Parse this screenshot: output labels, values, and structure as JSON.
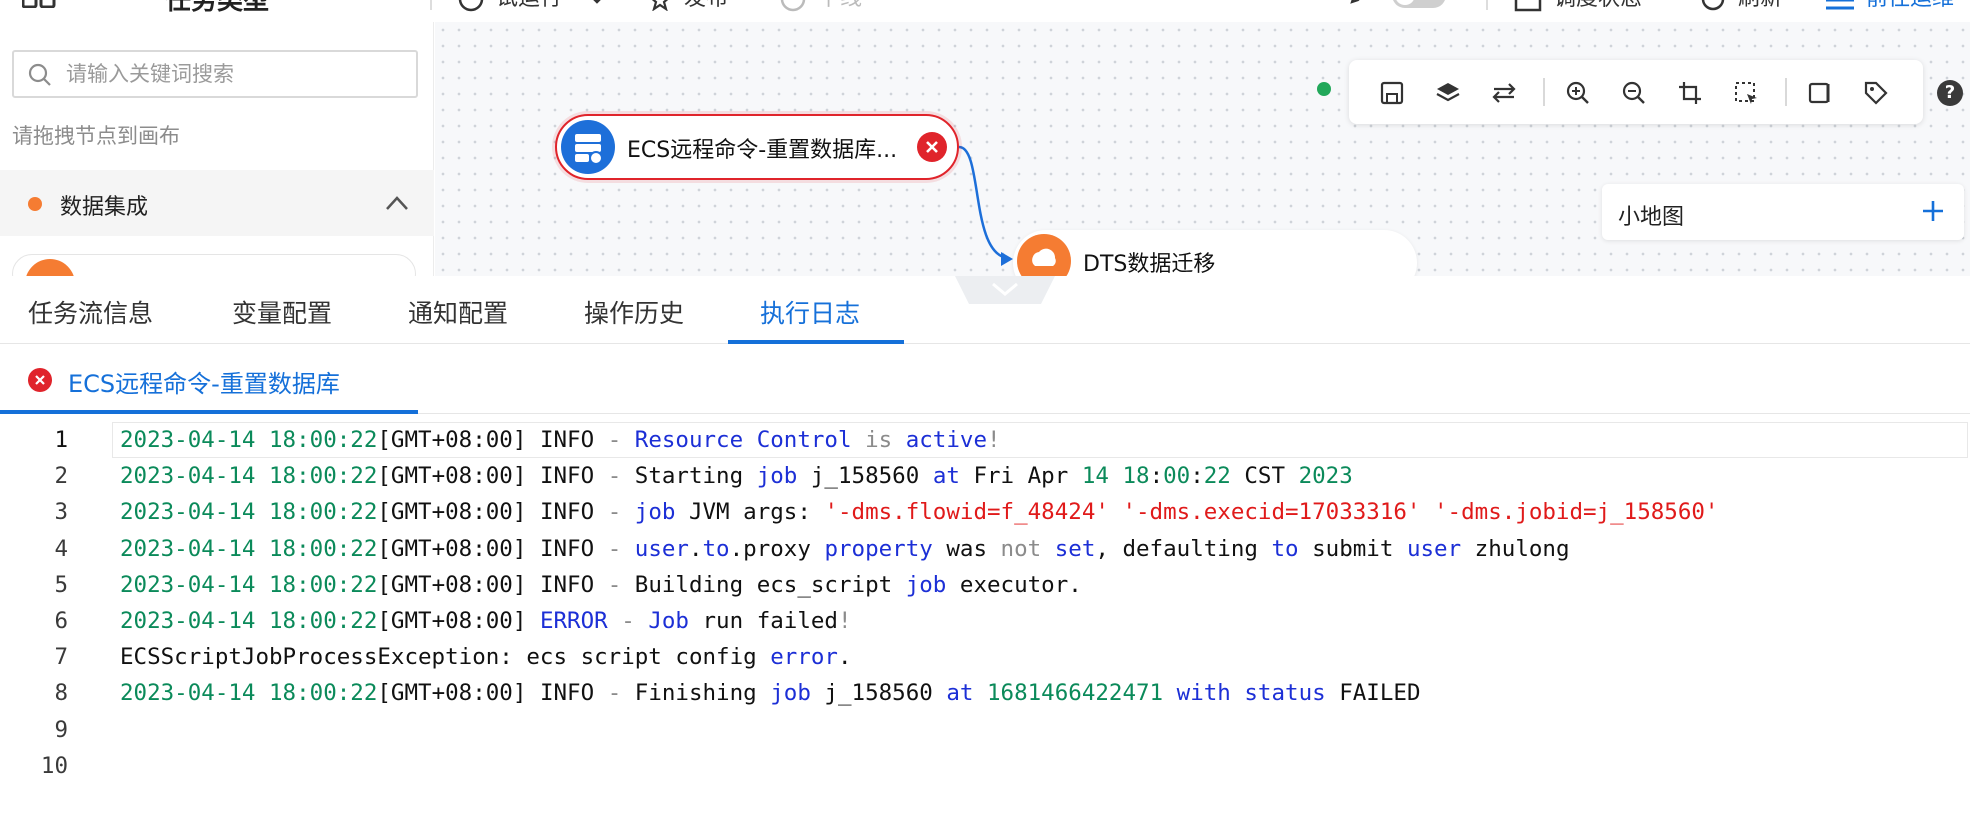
{
  "topbar": {
    "title": "任务类型",
    "run_label": "试运行",
    "publish_label": "发布",
    "offline_label": "下线",
    "schedule_status_label": "调度状态",
    "refresh_label": "刷新",
    "goto_label": "前往运维"
  },
  "left_panel": {
    "search_placeholder": "请输入关键词搜索",
    "drag_hint": "请拖拽节点到画布",
    "category": {
      "label": "数据集成",
      "dot_color": "#f57c32"
    }
  },
  "canvas": {
    "status_color": "#22a85a",
    "tools": [
      "save-icon",
      "layers-icon",
      "swap-icon",
      "zoom-in-icon",
      "zoom-out-icon",
      "crop-icon",
      "select-icon",
      "book-icon",
      "tag-icon"
    ],
    "help_label": "?",
    "minimap_label": "小地图",
    "nodes": [
      {
        "label": "ECS远程命令-重置数据库...",
        "status": "error",
        "icon_color": "#1d6fd9"
      },
      {
        "label": "DTS数据迁移",
        "status": "normal",
        "icon_color": "#f57c32"
      }
    ]
  },
  "bottom_panel": {
    "tabs": [
      {
        "label": "任务流信息",
        "active": false
      },
      {
        "label": "变量配置",
        "active": false
      },
      {
        "label": "通知配置",
        "active": false
      },
      {
        "label": "操作历史",
        "active": false
      },
      {
        "label": "执行日志",
        "active": true
      }
    ],
    "subtab_label": "ECS远程命令-重置数据库",
    "accent_color": "#1570d9",
    "error_color": "#e0242b",
    "log_lines": [
      {
        "num": "1",
        "tokens": [
          {
            "t": "2023-04-14 18:00:22",
            "c": "date"
          },
          {
            "t": "[GMT+08:00] INFO ",
            "c": "plain"
          },
          {
            "t": "- ",
            "c": "op"
          },
          {
            "t": "Resource Control",
            "c": "kw"
          },
          {
            "t": " ",
            "c": "plain"
          },
          {
            "t": "is",
            "c": "op"
          },
          {
            "t": " ",
            "c": "plain"
          },
          {
            "t": "active",
            "c": "kw"
          },
          {
            "t": "!",
            "c": "op"
          }
        ]
      },
      {
        "num": "2",
        "tokens": [
          {
            "t": "2023-04-14 18:00:22",
            "c": "date"
          },
          {
            "t": "[GMT+08:00] INFO ",
            "c": "plain"
          },
          {
            "t": "- ",
            "c": "op"
          },
          {
            "t": "Starting ",
            "c": "plain"
          },
          {
            "t": "job",
            "c": "kw"
          },
          {
            "t": " j_158560 ",
            "c": "plain"
          },
          {
            "t": "at",
            "c": "kw"
          },
          {
            "t": " Fri Apr ",
            "c": "plain"
          },
          {
            "t": "14 18",
            "c": "num"
          },
          {
            "t": ":",
            "c": "plain"
          },
          {
            "t": "00",
            "c": "num"
          },
          {
            "t": ":",
            "c": "plain"
          },
          {
            "t": "22",
            "c": "num"
          },
          {
            "t": " CST ",
            "c": "plain"
          },
          {
            "t": "2023",
            "c": "num"
          }
        ]
      },
      {
        "num": "3",
        "tokens": [
          {
            "t": "2023-04-14 18:00:22",
            "c": "date"
          },
          {
            "t": "[GMT+08:00] INFO ",
            "c": "plain"
          },
          {
            "t": "- ",
            "c": "op"
          },
          {
            "t": "job",
            "c": "kw"
          },
          {
            "t": " JVM args: ",
            "c": "plain"
          },
          {
            "t": "'-dms.flowid=f_48424' '-dms.execid=17033316' '-dms.jobid=j_158560'",
            "c": "str"
          }
        ]
      },
      {
        "num": "4",
        "tokens": [
          {
            "t": "2023-04-14 18:00:22",
            "c": "date"
          },
          {
            "t": "[GMT+08:00] INFO ",
            "c": "plain"
          },
          {
            "t": "- ",
            "c": "op"
          },
          {
            "t": "user",
            "c": "kw"
          },
          {
            "t": ".",
            "c": "plain"
          },
          {
            "t": "to",
            "c": "kw"
          },
          {
            "t": ".proxy ",
            "c": "plain"
          },
          {
            "t": "property",
            "c": "kw"
          },
          {
            "t": " was ",
            "c": "plain"
          },
          {
            "t": "not",
            "c": "op"
          },
          {
            "t": " ",
            "c": "plain"
          },
          {
            "t": "set",
            "c": "kw"
          },
          {
            "t": ", defaulting ",
            "c": "plain"
          },
          {
            "t": "to",
            "c": "kw"
          },
          {
            "t": " submit ",
            "c": "plain"
          },
          {
            "t": "user",
            "c": "kw"
          },
          {
            "t": " zhulong",
            "c": "plain"
          }
        ]
      },
      {
        "num": "5",
        "tokens": [
          {
            "t": "2023-04-14 18:00:22",
            "c": "date"
          },
          {
            "t": "[GMT+08:00] INFO ",
            "c": "plain"
          },
          {
            "t": "- ",
            "c": "op"
          },
          {
            "t": "Building ecs_script ",
            "c": "plain"
          },
          {
            "t": "job",
            "c": "kw"
          },
          {
            "t": " executor.",
            "c": "plain"
          }
        ]
      },
      {
        "num": "6",
        "tokens": [
          {
            "t": "2023-04-14 18:00:22",
            "c": "date"
          },
          {
            "t": "[GMT+08:00] ",
            "c": "plain"
          },
          {
            "t": "ERROR",
            "c": "kw"
          },
          {
            "t": " - ",
            "c": "op"
          },
          {
            "t": "Job",
            "c": "kw"
          },
          {
            "t": " run failed",
            "c": "plain"
          },
          {
            "t": "!",
            "c": "op"
          }
        ]
      },
      {
        "num": "7",
        "tokens": [
          {
            "t": "ECSScriptJobProcessException: ecs script config ",
            "c": "plain"
          },
          {
            "t": "error",
            "c": "kw"
          },
          {
            "t": ".",
            "c": "plain"
          }
        ]
      },
      {
        "num": "8",
        "tokens": [
          {
            "t": "2023-04-14 18:00:22",
            "c": "date"
          },
          {
            "t": "[GMT+08:00] INFO ",
            "c": "plain"
          },
          {
            "t": "- ",
            "c": "op"
          },
          {
            "t": "Finishing ",
            "c": "plain"
          },
          {
            "t": "job",
            "c": "kw"
          },
          {
            "t": " j_158560 ",
            "c": "plain"
          },
          {
            "t": "at",
            "c": "kw"
          },
          {
            "t": " ",
            "c": "plain"
          },
          {
            "t": "1681466422471",
            "c": "num"
          },
          {
            "t": " ",
            "c": "plain"
          },
          {
            "t": "with status",
            "c": "kw"
          },
          {
            "t": " FAILED",
            "c": "plain"
          }
        ]
      },
      {
        "num": "9",
        "tokens": []
      },
      {
        "num": "10",
        "tokens": []
      }
    ]
  }
}
